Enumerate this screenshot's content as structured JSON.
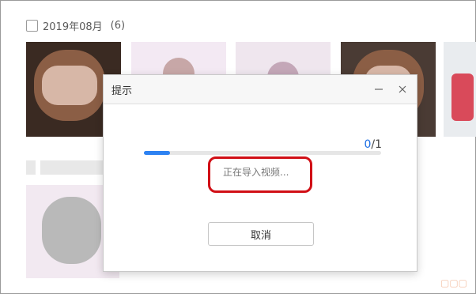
{
  "gallery": {
    "group1": {
      "label": "2019年08月",
      "count": "(6)"
    },
    "group2": {
      "label": ""
    }
  },
  "dialog": {
    "title": "提示",
    "progress": {
      "current": "0",
      "total": "/1",
      "value": 0.11
    },
    "status": "正在导入视频...",
    "cancel_label": "取消"
  },
  "colors": {
    "accent": "#2d82f2",
    "highlight": "#d10f16"
  },
  "icons": {
    "minimize": "minimize-icon",
    "close": "close-icon"
  }
}
